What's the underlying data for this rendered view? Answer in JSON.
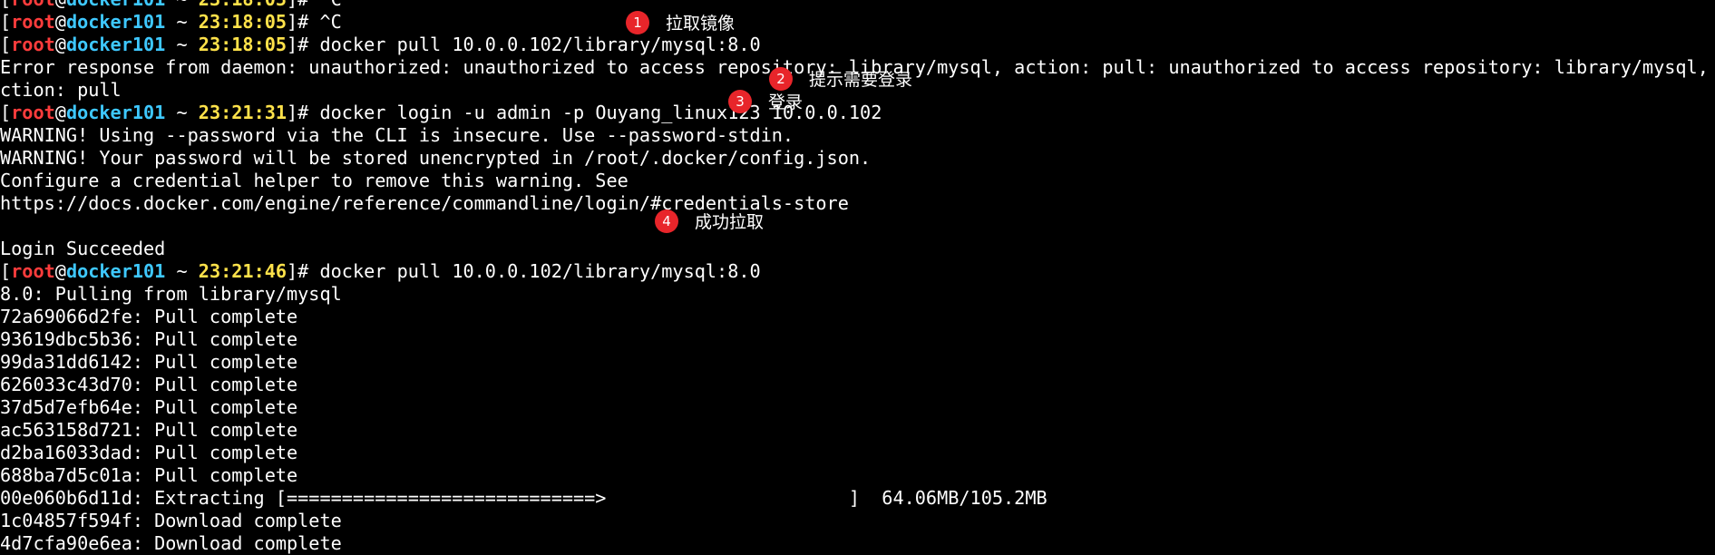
{
  "terminal": {
    "lines": [
      {
        "type": "prompt",
        "user": "root",
        "host": "docker101",
        "path": "~",
        "time": "23:18:05",
        "cmd": "^C"
      },
      {
        "type": "prompt",
        "user": "root",
        "host": "docker101",
        "path": "~",
        "time": "23:18:05",
        "cmd": "^C"
      },
      {
        "type": "prompt",
        "user": "root",
        "host": "docker101",
        "path": "~",
        "time": "23:18:05",
        "cmd": "docker pull 10.0.0.102/library/mysql:8.0"
      },
      {
        "type": "output",
        "text": "Error response from daemon: unauthorized: unauthorized to access repository: library/mysql, action: pull: unauthorized to access repository: library/mysql, a"
      },
      {
        "type": "output",
        "text": "ction: pull"
      },
      {
        "type": "prompt",
        "user": "root",
        "host": "docker101",
        "path": "~",
        "time": "23:21:31",
        "cmd": "docker login -u admin -p Ouyang_linux123 10.0.0.102"
      },
      {
        "type": "output",
        "text": "WARNING! Using --password via the CLI is insecure. Use --password-stdin."
      },
      {
        "type": "output",
        "text": "WARNING! Your password will be stored unencrypted in /root/.docker/config.json."
      },
      {
        "type": "output",
        "text": "Configure a credential helper to remove this warning. See"
      },
      {
        "type": "output",
        "text": "https://docs.docker.com/engine/reference/commandline/login/#credentials-store"
      },
      {
        "type": "output",
        "text": ""
      },
      {
        "type": "output",
        "text": "Login Succeeded"
      },
      {
        "type": "prompt",
        "user": "root",
        "host": "docker101",
        "path": "~",
        "time": "23:21:46",
        "cmd": "docker pull 10.0.0.102/library/mysql:8.0"
      },
      {
        "type": "output",
        "text": "8.0: Pulling from library/mysql"
      },
      {
        "type": "output",
        "text": "72a69066d2fe: Pull complete"
      },
      {
        "type": "output",
        "text": "93619dbc5b36: Pull complete"
      },
      {
        "type": "output",
        "text": "99da31dd6142: Pull complete"
      },
      {
        "type": "output",
        "text": "626033c43d70: Pull complete"
      },
      {
        "type": "output",
        "text": "37d5d7efb64e: Pull complete"
      },
      {
        "type": "output",
        "text": "ac563158d721: Pull complete"
      },
      {
        "type": "output",
        "text": "d2ba16033dad: Pull complete"
      },
      {
        "type": "output",
        "text": "688ba7d5c01a: Pull complete"
      },
      {
        "type": "output",
        "text": "00e060b6d11d: Extracting [============================>                      ]  64.06MB/105.2MB"
      },
      {
        "type": "output",
        "text": "1c04857f594f: Download complete"
      },
      {
        "type": "output",
        "text": "4d7cfa90e6ea: Download complete"
      }
    ]
  },
  "annotations": [
    {
      "number": "1",
      "label": "拉取镜像"
    },
    {
      "number": "2",
      "label": "提示需要登录"
    },
    {
      "number": "3",
      "label": "登录"
    },
    {
      "number": "4",
      "label": "成功拉取"
    }
  ],
  "colors": {
    "background": "#000000",
    "user": "#ff3c3c",
    "host": "#3ec8ff",
    "time": "#ffe24a",
    "badge": "#e8252a"
  }
}
